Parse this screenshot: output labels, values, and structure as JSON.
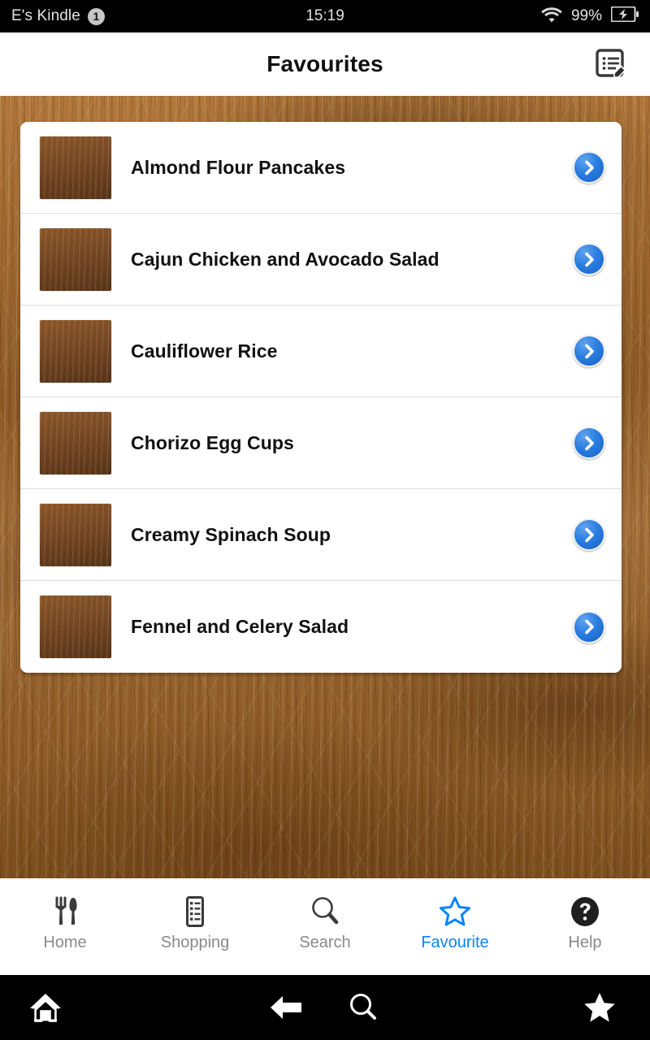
{
  "status_bar": {
    "device": "E's Kindle",
    "badge_count": "1",
    "time": "15:19",
    "wifi_icon": "wifi-icon",
    "battery_percent": "99%",
    "battery_icon": "battery-charging-icon"
  },
  "header": {
    "title": "Favourites",
    "action_icon": "edit-list-icon"
  },
  "list": {
    "items": [
      {
        "title": "Almond Flour Pancakes",
        "thumb_alt": "almond-flour-pancakes-thumbnail",
        "chevron_icon": "chevron-right-icon"
      },
      {
        "title": "Cajun Chicken and Avocado Salad",
        "thumb_alt": "cajun-chicken-avocado-salad-thumbnail",
        "chevron_icon": "chevron-right-icon"
      },
      {
        "title": "Cauliflower Rice",
        "thumb_alt": "cauliflower-rice-thumbnail",
        "chevron_icon": "chevron-right-icon"
      },
      {
        "title": "Chorizo Egg Cups",
        "thumb_alt": "chorizo-egg-cups-thumbnail",
        "chevron_icon": "chevron-right-icon"
      },
      {
        "title": "Creamy Spinach Soup",
        "thumb_alt": "creamy-spinach-soup-thumbnail",
        "chevron_icon": "chevron-right-icon"
      },
      {
        "title": "Fennel and Celery Salad",
        "thumb_alt": "fennel-celery-salad-thumbnail",
        "chevron_icon": "chevron-right-icon"
      }
    ]
  },
  "tab_bar": {
    "tabs": [
      {
        "label": "Home",
        "icon": "cutlery-icon",
        "active": false
      },
      {
        "label": "Shopping",
        "icon": "clipboard-list-icon",
        "active": false
      },
      {
        "label": "Search",
        "icon": "magnifier-icon",
        "active": false
      },
      {
        "label": "Favourite",
        "icon": "star-outline-icon",
        "active": true
      },
      {
        "label": "Help",
        "icon": "question-circle-icon",
        "active": false
      }
    ]
  },
  "system_nav": {
    "buttons": [
      {
        "name": "home",
        "icon": "home-icon"
      },
      {
        "name": "back",
        "icon": "back-arrow-icon"
      },
      {
        "name": "search",
        "icon": "search-icon"
      },
      {
        "name": "bookmark",
        "icon": "star-filled-icon"
      }
    ]
  },
  "colors": {
    "accent": "#0a84ff",
    "chevron_blue": "#2a7de0",
    "inactive_label": "#8a8a8a",
    "wood": "#9a6430"
  }
}
